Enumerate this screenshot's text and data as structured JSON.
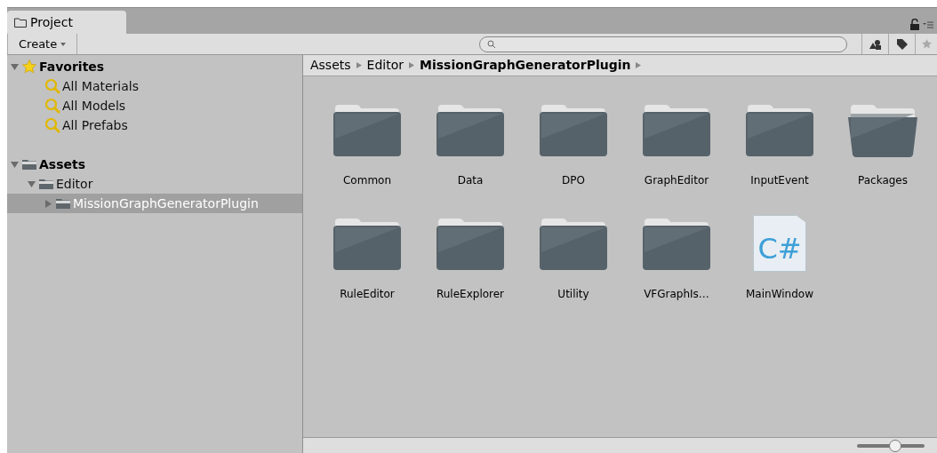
{
  "window": {
    "tab": "Project"
  },
  "toolbar": {
    "create_button": "Create"
  },
  "sidebar": {
    "sections": [
      {
        "label": "Favorites",
        "kind": "favorites",
        "expanded": true,
        "children": [
          {
            "label": "All Materials",
            "kind": "search",
            "selected": false
          },
          {
            "label": "All Models",
            "kind": "search",
            "selected": false
          },
          {
            "label": "All Prefabs",
            "kind": "search",
            "selected": false
          }
        ]
      },
      {
        "label": "Assets",
        "kind": "folder",
        "expanded": true,
        "children": [
          {
            "label": "Editor",
            "kind": "folder",
            "expanded": true,
            "selected": false,
            "children": [
              {
                "label": "MissionGraphGeneratorPlugin",
                "kind": "folder",
                "expanded": false,
                "selected": true
              }
            ]
          }
        ]
      }
    ]
  },
  "breadcrumb": [
    {
      "label": "Assets",
      "current": false
    },
    {
      "label": "Editor",
      "current": false
    },
    {
      "label": "MissionGraphGeneratorPlugin",
      "current": true
    }
  ],
  "items": [
    {
      "label": "Common",
      "kind": "folder"
    },
    {
      "label": "Data",
      "kind": "folder"
    },
    {
      "label": "DPO",
      "kind": "folder"
    },
    {
      "label": "GraphEditor",
      "kind": "folder"
    },
    {
      "label": "InputEvent",
      "kind": "folder"
    },
    {
      "label": "Packages",
      "kind": "open-folder"
    },
    {
      "label": "RuleEditor",
      "kind": "folder"
    },
    {
      "label": "RuleExplorer",
      "kind": "folder"
    },
    {
      "label": "Utility",
      "kind": "folder"
    },
    {
      "label": "VFGraphIs…",
      "kind": "folder"
    },
    {
      "label": "MainWindow",
      "kind": "script",
      "script_label": "C#"
    }
  ],
  "zoom_slider": {
    "level": 0.56
  }
}
